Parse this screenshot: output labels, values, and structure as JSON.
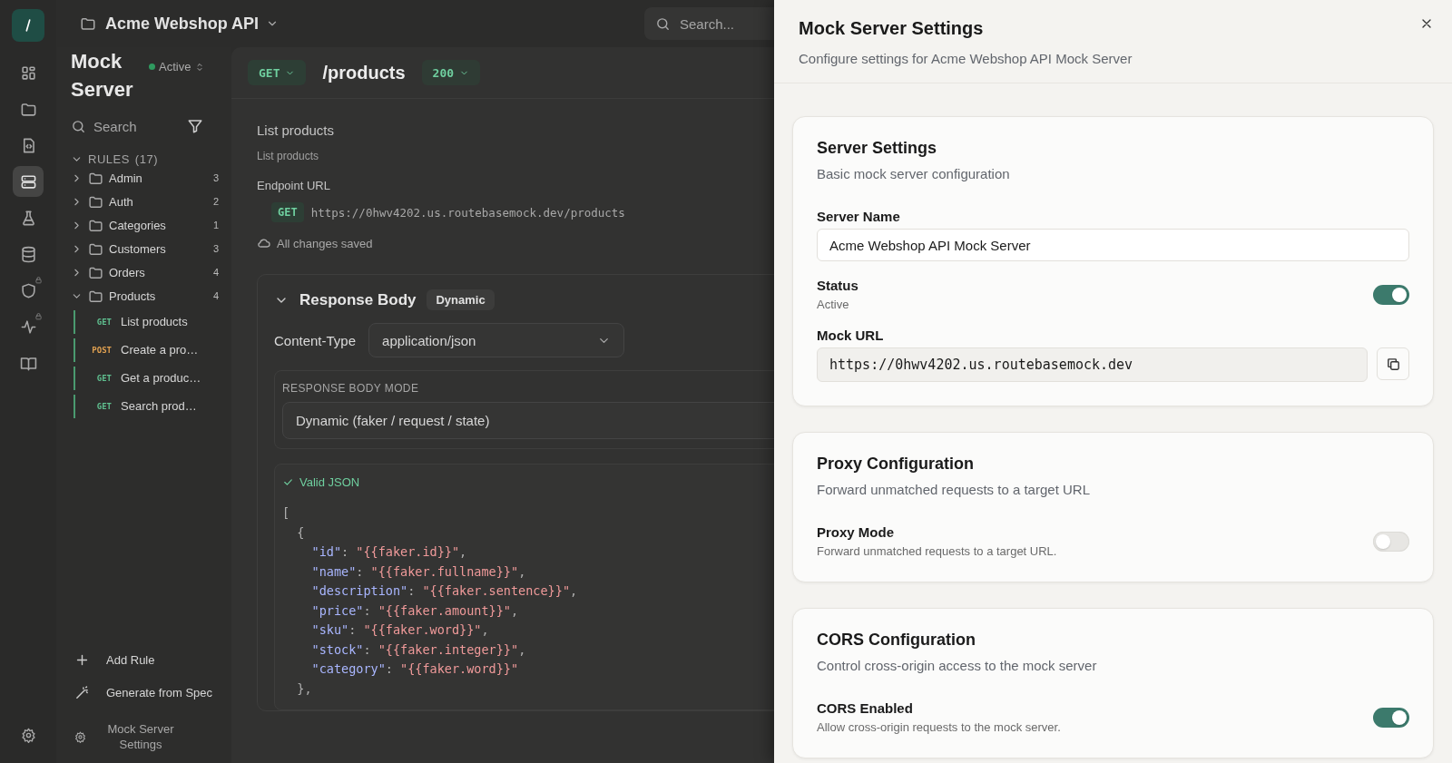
{
  "topbar": {
    "workspace": "Acme Webshop API",
    "search": {
      "placeholder": "Search..."
    }
  },
  "rail": {
    "items": [
      {
        "kind": "grid",
        "selected": false,
        "locked": false
      },
      {
        "kind": "folder",
        "selected": false,
        "locked": false
      },
      {
        "kind": "file-code",
        "selected": false,
        "locked": false
      },
      {
        "kind": "server",
        "selected": true,
        "locked": false
      },
      {
        "kind": "flask",
        "selected": false,
        "locked": false
      },
      {
        "kind": "database",
        "selected": false,
        "locked": false
      },
      {
        "kind": "shield",
        "selected": false,
        "locked": true
      },
      {
        "kind": "activity",
        "selected": false,
        "locked": true
      },
      {
        "kind": "book",
        "selected": false,
        "locked": false
      }
    ]
  },
  "sidebar": {
    "title": "Mock Server",
    "status": "Active",
    "status_active": true,
    "search": {
      "placeholder": "Search"
    },
    "rules_label": "RULES",
    "rules_count": "(17)",
    "rules_expanded": true,
    "folders": [
      {
        "name": "Admin",
        "count": "3",
        "expanded": false
      },
      {
        "name": "Auth",
        "count": "2",
        "expanded": false
      },
      {
        "name": "Categories",
        "count": "1",
        "expanded": false
      },
      {
        "name": "Customers",
        "count": "3",
        "expanded": false
      },
      {
        "name": "Orders",
        "count": "4",
        "expanded": false
      },
      {
        "name": "Products",
        "count": "4",
        "expanded": true,
        "children": [
          {
            "method": "GET",
            "name": "List products"
          },
          {
            "method": "POST",
            "name": "Create a pro…"
          },
          {
            "method": "GET",
            "name": "Get a produc…"
          },
          {
            "method": "GET",
            "name": "Search prod…"
          }
        ]
      }
    ],
    "actions": [
      {
        "kind": "add",
        "label": "Add Rule"
      },
      {
        "kind": "wand",
        "label": "Generate from Spec"
      }
    ],
    "settings_link": "Mock Server Settings"
  },
  "main": {
    "method": "GET",
    "path": "/products",
    "status_code": "200",
    "name": "List products",
    "description": "List products",
    "endpoint_label": "Endpoint URL",
    "endpoint_method": "GET",
    "endpoint_url": "https://0hwv4202.us.routebasemock.dev/products",
    "save_status": "All changes saved",
    "response": {
      "title": "Response Body",
      "badge": "Dynamic",
      "expanded": true,
      "content_type_label": "Content-Type",
      "content_type": "application/json",
      "mode_label": "RESPONSE BODY MODE",
      "mode": "Dynamic (faker / request / state)",
      "validity": "Valid JSON",
      "code": [
        "[",
        "  {",
        "    \"id\": \"{{faker.id}}\",",
        "    \"name\": \"{{faker.fullname}}\",",
        "    \"description\": \"{{faker.sentence}}\",",
        "    \"price\": \"{{faker.amount}}\",",
        "    \"sku\": \"{{faker.word}}\",",
        "    \"stock\": \"{{faker.integer}}\",",
        "    \"category\": \"{{faker.word}}\"",
        "  },"
      ]
    }
  },
  "drawer": {
    "title": "Mock Server Settings",
    "subtitle": "Configure settings for Acme Webshop API Mock Server",
    "sections": [
      {
        "title": "Server Settings",
        "subtitle": "Basic mock server configuration",
        "fields": [
          {
            "kind": "text",
            "label": "Server Name",
            "value": "Acme Webshop API Mock Server"
          },
          {
            "kind": "toggle",
            "label": "Status",
            "hint": "Active",
            "on": true
          },
          {
            "kind": "url",
            "label": "Mock URL",
            "value": "https://0hwv4202.us.routebasemock.dev"
          }
        ]
      },
      {
        "title": "Proxy Configuration",
        "subtitle": "Forward unmatched requests to a target URL",
        "fields": [
          {
            "kind": "toggle",
            "label": "Proxy Mode",
            "hint": "Forward unmatched requests to a target URL.",
            "on": false
          }
        ]
      },
      {
        "title": "CORS Configuration",
        "subtitle": "Control cross-origin access to the mock server",
        "fields": [
          {
            "kind": "toggle",
            "label": "CORS Enabled",
            "hint": "Allow cross-origin requests to the mock server.",
            "on": true
          }
        ]
      }
    ]
  }
}
